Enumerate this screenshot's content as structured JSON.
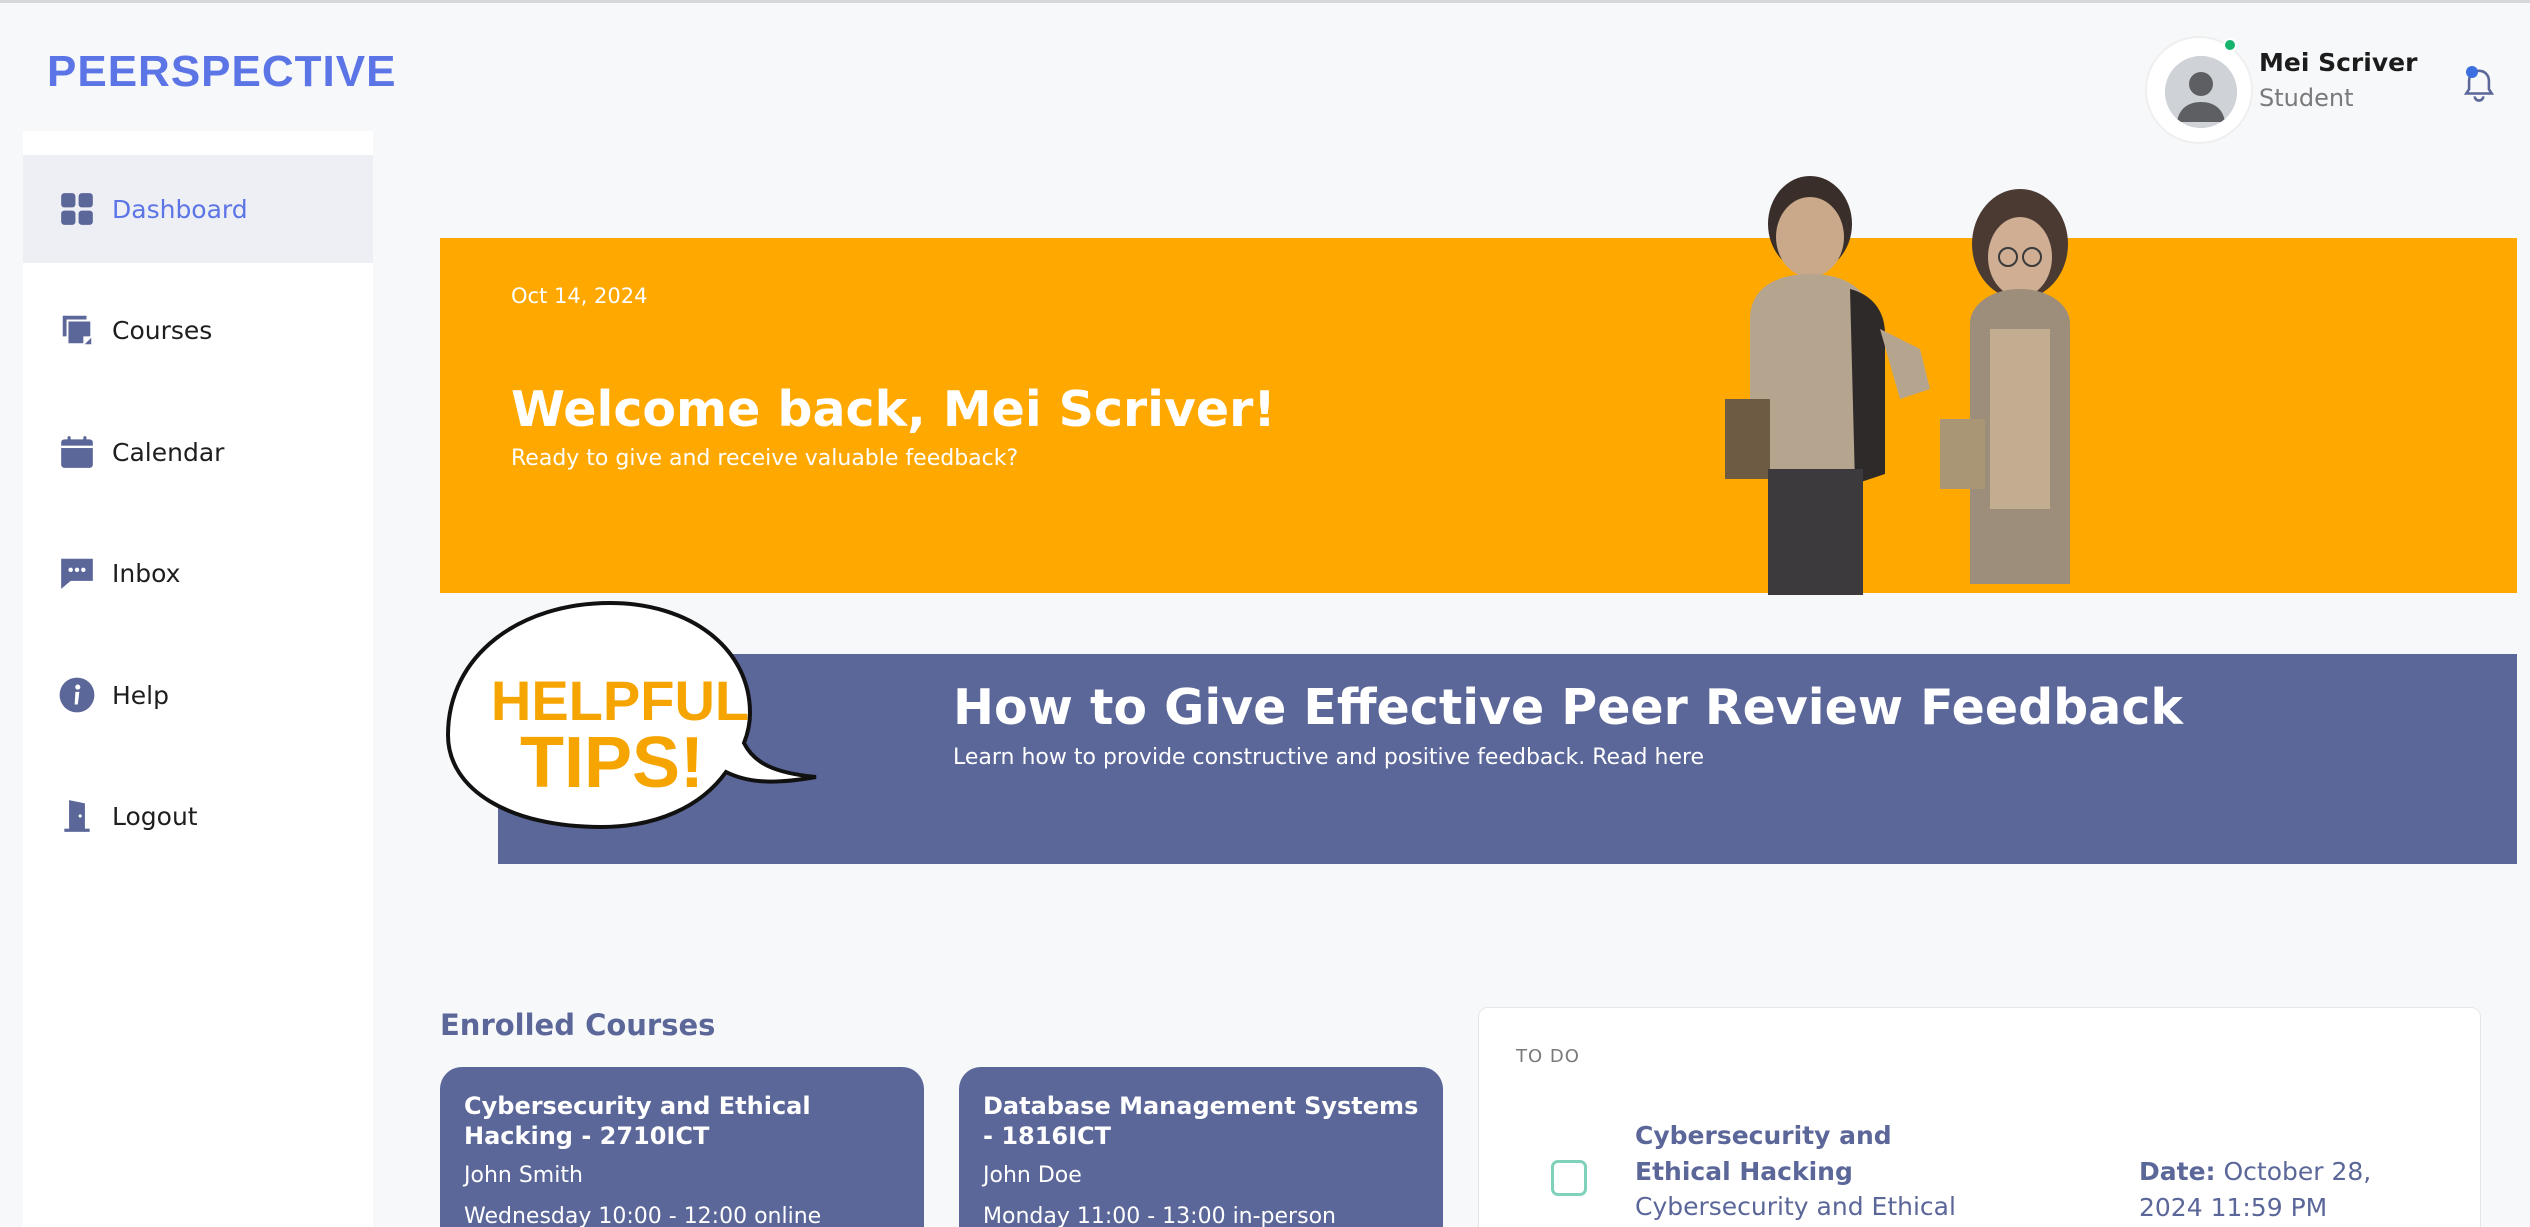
{
  "brand": "PEERSPECTIVE",
  "sidebar": {
    "items": [
      {
        "label": "Dashboard",
        "icon": "grid-icon",
        "active": true
      },
      {
        "label": "Courses",
        "icon": "note-icon"
      },
      {
        "label": "Calendar",
        "icon": "calendar-icon"
      },
      {
        "label": "Inbox",
        "icon": "chat-icon"
      },
      {
        "label": "Help",
        "icon": "info-icon"
      },
      {
        "label": "Logout",
        "icon": "door-icon"
      }
    ]
  },
  "user": {
    "name": "Mei Scriver",
    "role": "Student"
  },
  "hero": {
    "date": "Oct 14, 2024",
    "title": "Welcome back, Mei Scriver!",
    "subtitle": "Ready to give and receive valuable feedback?"
  },
  "tips": {
    "bubble_line1": "HELPFUL",
    "bubble_line2": "TIPS!",
    "title": "How to Give Effective Peer Review Feedback",
    "subtitle": "Learn how to provide constructive and positive feedback. Read here"
  },
  "enrolled": {
    "title": "Enrolled Courses",
    "courses": [
      {
        "title": "Cybersecurity and Ethical Hacking - 2710ICT",
        "instructor": "John Smith",
        "schedule": "Wednesday 10:00 - 12:00 online"
      },
      {
        "title": "Database Management Systems - 1816ICT",
        "instructor": "John Doe",
        "schedule": "Monday 11:00 - 13:00 in-person"
      }
    ]
  },
  "todo": {
    "label": "TO DO",
    "items": [
      {
        "title": "Cybersecurity and Ethical Hacking",
        "course": "Cybersecurity and Ethical",
        "date_label": "Date:",
        "date": "October 28, 2024 11:59 PM"
      }
    ]
  },
  "colors": {
    "brand": "#5b74e6",
    "hero": "#ffa800",
    "banner": "#5b6699",
    "online": "#16b46d"
  }
}
